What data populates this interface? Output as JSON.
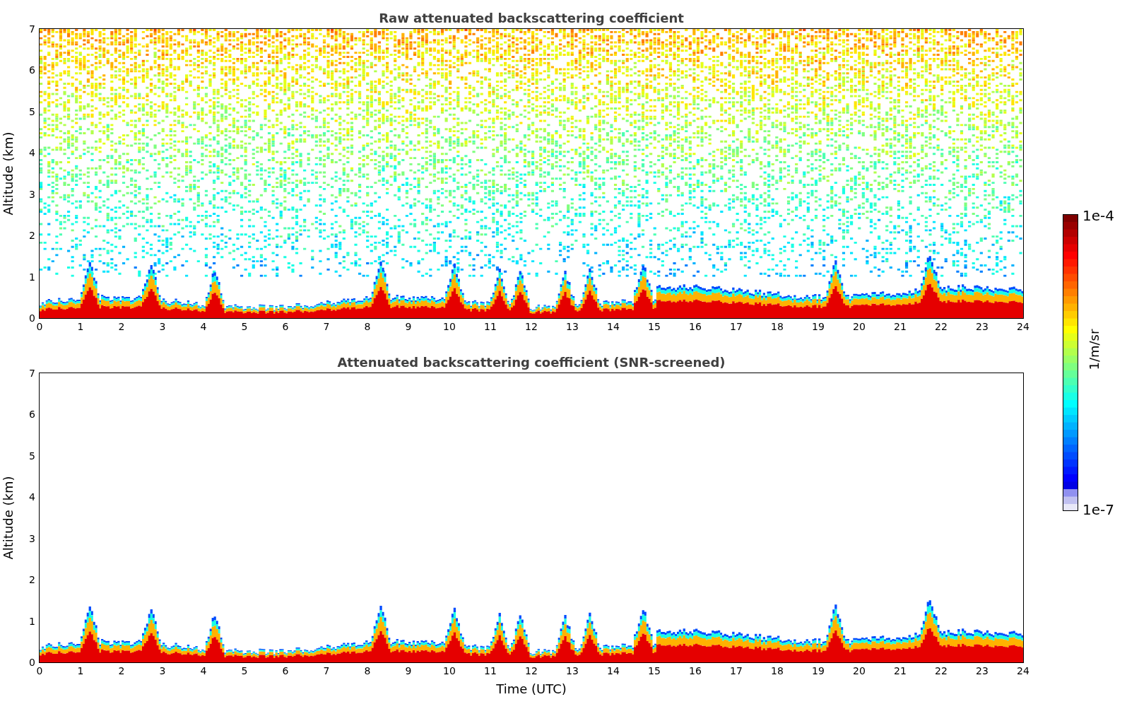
{
  "panels": [
    {
      "kind": "raw",
      "title": "Raw attenuated backscattering coefficient",
      "ylabel": "Altitude (km)",
      "yticks": [
        "7",
        "6",
        "5",
        "4",
        "3",
        "2",
        "1",
        "0"
      ],
      "xticks": [
        "0",
        "1",
        "2",
        "3",
        "4",
        "5",
        "6",
        "7",
        "8",
        "9",
        "10",
        "11",
        "12",
        "13",
        "14",
        "15",
        "16",
        "17",
        "18",
        "19",
        "20",
        "21",
        "22",
        "23",
        "24"
      ]
    },
    {
      "kind": "screened",
      "title": "Attenuated backscattering coefficient (SNR-screened)",
      "ylabel": "Altitude (km)",
      "yticks": [
        "7",
        "6",
        "5",
        "4",
        "3",
        "2",
        "1",
        "0"
      ],
      "xticks": [
        "0",
        "1",
        "2",
        "3",
        "4",
        "5",
        "6",
        "7",
        "8",
        "9",
        "10",
        "11",
        "12",
        "13",
        "14",
        "15",
        "16",
        "17",
        "18",
        "19",
        "20",
        "21",
        "22",
        "23",
        "24"
      ]
    }
  ],
  "xlabel": "Time (UTC)",
  "colorbar": {
    "max_label": "1e-4",
    "min_label": "1e-7",
    "unit": "1/m/sr"
  }
}
